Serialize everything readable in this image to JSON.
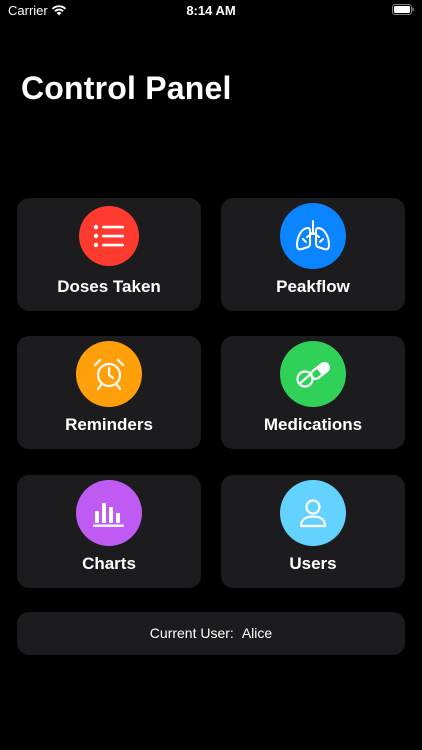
{
  "status_bar": {
    "carrier": "Carrier",
    "time": "8:14 AM",
    "icons": [
      "wifi-icon",
      "battery-icon"
    ]
  },
  "title": "Control Panel",
  "tiles": [
    {
      "label": "Doses Taken",
      "icon": "list-icon",
      "color": "#ff3b30"
    },
    {
      "label": "Peakflow",
      "icon": "lungs-icon",
      "color": "#0a84ff"
    },
    {
      "label": "Reminders",
      "icon": "alarm-clock-icon",
      "color": "#ff9f0a"
    },
    {
      "label": "Medications",
      "icon": "pills-icon",
      "color": "#30d158"
    },
    {
      "label": "Charts",
      "icon": "bar-chart-icon",
      "color": "#bf5af2"
    },
    {
      "label": "Users",
      "icon": "person-icon",
      "color": "#64d2ff"
    }
  ],
  "current_user": {
    "label": "Current User:",
    "name": "Alice"
  },
  "colors": {
    "background": "#000000",
    "tile_background": "#1c1c1e",
    "text": "#ffffff"
  }
}
